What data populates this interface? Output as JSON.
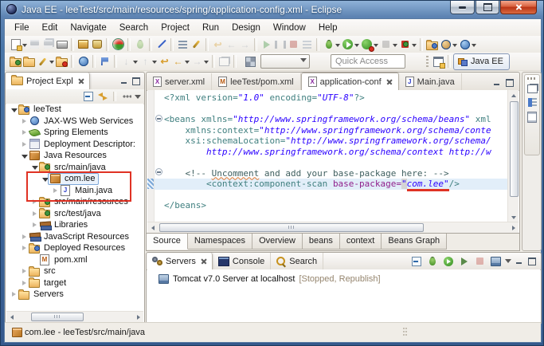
{
  "window": {
    "title": "Java EE - leeTest/src/main/resources/spring/application-config.xml - Eclipse"
  },
  "menu_bar": {
    "items": [
      "File",
      "Edit",
      "Navigate",
      "Search",
      "Project",
      "Run",
      "Design",
      "Window",
      "Help"
    ]
  },
  "toolbar": {
    "quick_access": {
      "placeholder": "Quick Access"
    },
    "perspective": {
      "label": "Java EE"
    },
    "row1_icon_names": [
      "new-wizard-icon",
      "save-icon",
      "save-all-icon",
      "print-icon",
      "export-jar-icon",
      "javadoc-icon",
      "maven-update-icon",
      "skip-breakpoints-icon",
      "mark-occurrences-icon",
      "pin-editor-icon",
      "resume-icon",
      "suspend-icon",
      "terminate-icon",
      "debug-icon",
      "run-icon",
      "coverage-icon",
      "stop-icon",
      "relaunch-icon",
      "new-server-icon",
      "web-browser-icon"
    ],
    "row2_icon_names": [
      "import-icon",
      "export-icon",
      "highlighter-icon",
      "synchronize-icon",
      "web-globe-icon",
      "validate-icon",
      "next-annotation-icon",
      "previous-annotation-icon",
      "last-edit-location-icon",
      "back-icon",
      "forward-icon",
      "grid-view-icon",
      "open-perspective-icon"
    ]
  },
  "file_icons": {
    "xml": "X",
    "maven": "M",
    "java": "J"
  },
  "project_explorer": {
    "title": "Project Expl",
    "tree": [
      {
        "label": "leeTest",
        "depth": 0,
        "state": "expanded",
        "icon": "project"
      },
      {
        "label": "JAX-WS Web Services",
        "depth": 1,
        "state": "collapsed",
        "icon": "webservices"
      },
      {
        "label": "Spring Elements",
        "depth": 1,
        "state": "collapsed",
        "icon": "spring-leaf"
      },
      {
        "label": "Deployment Descriptor:",
        "depth": 1,
        "state": "collapsed",
        "icon": "descriptor"
      },
      {
        "label": "Java Resources",
        "depth": 1,
        "state": "expanded",
        "icon": "java-resources"
      },
      {
        "label": "src/main/java",
        "depth": 2,
        "state": "expanded",
        "icon": "source-folder"
      },
      {
        "label": "com.lee",
        "depth": 3,
        "state": "expanded",
        "icon": "package",
        "selected": true,
        "annotated": true
      },
      {
        "label": "Main.java",
        "depth": 4,
        "state": "collapsed",
        "icon": "java-file",
        "annotated": true
      },
      {
        "label": "src/main/resources",
        "depth": 2,
        "state": "collapsed",
        "icon": "source-folder"
      },
      {
        "label": "src/test/java",
        "depth": 2,
        "state": "collapsed",
        "icon": "source-folder"
      },
      {
        "label": "Libraries",
        "depth": 2,
        "state": "collapsed",
        "icon": "libraries"
      },
      {
        "label": "JavaScript Resources",
        "depth": 1,
        "state": "collapsed",
        "icon": "libraries"
      },
      {
        "label": "Deployed Resources",
        "depth": 1,
        "state": "collapsed",
        "icon": "deployed-folder"
      },
      {
        "label": "pom.xml",
        "depth": 1,
        "state": "leaf",
        "icon": "maven-file"
      },
      {
        "label": "src",
        "depth": 1,
        "state": "collapsed",
        "icon": "folder"
      },
      {
        "label": "target",
        "depth": 1,
        "state": "collapsed",
        "icon": "folder"
      },
      {
        "label": "Servers",
        "depth": 0,
        "state": "collapsed",
        "icon": "folder"
      }
    ]
  },
  "editor": {
    "tabs": [
      {
        "label": "server.xml",
        "icon": "xml",
        "active": false
      },
      {
        "label": "leeTest/pom.xml",
        "icon": "maven",
        "active": false
      },
      {
        "label": "application-conf",
        "icon": "xml",
        "active": true
      },
      {
        "label": "Main.java",
        "icon": "java",
        "active": false
      }
    ],
    "page_tabs": [
      {
        "label": "Source",
        "active": true
      },
      {
        "label": "Namespaces",
        "active": false
      },
      {
        "label": "Overview",
        "active": false
      },
      {
        "label": "beans",
        "active": false
      },
      {
        "label": "context",
        "active": false
      },
      {
        "label": "Beans Graph",
        "active": false
      }
    ],
    "code": [
      {
        "s": [
          {
            "t": "<?xml ",
            "k": "tag"
          },
          {
            "t": "version=",
            "k": "attr"
          },
          {
            "t": "\"1.0\"",
            "k": "val"
          },
          {
            "t": " ",
            "k": "txt"
          },
          {
            "t": "encoding=",
            "k": "attr"
          },
          {
            "t": "\"UTF-8\"",
            "k": "val"
          },
          {
            "t": "?>",
            "k": "tag"
          }
        ]
      },
      {
        "s": []
      },
      {
        "s": [
          {
            "t": "<beans ",
            "k": "tag"
          },
          {
            "t": "xmlns=",
            "k": "attr"
          },
          {
            "t": "\"http://www.springframework.org/schema/beans\"",
            "k": "val"
          },
          {
            "t": " ",
            "k": "txt"
          },
          {
            "t": "xml",
            "k": "attr"
          }
        ]
      },
      {
        "s": [
          {
            "t": "    ",
            "k": "txt"
          },
          {
            "t": "xmlns:context=",
            "k": "attr"
          },
          {
            "t": "\"http://www.springframework.org/schema/conte",
            "k": "val"
          }
        ]
      },
      {
        "s": [
          {
            "t": "    ",
            "k": "txt"
          },
          {
            "t": "xsi:schemaLocation=",
            "k": "attr"
          },
          {
            "t": "\"http://www.springframework.org/schema/",
            "k": "val"
          }
        ]
      },
      {
        "s": [
          {
            "t": "        ",
            "k": "txt"
          },
          {
            "t": "http://www.springframework.org/schema/context http://w",
            "k": "val"
          }
        ]
      },
      {
        "s": []
      },
      {
        "s": [
          {
            "t": "    ",
            "k": "txt"
          },
          {
            "t": "<!-- ",
            "k": "com"
          },
          {
            "t": "Uncomment",
            "k": "comsp"
          },
          {
            "t": " and add your base-package here: -->",
            "k": "com"
          }
        ]
      },
      {
        "s": [
          {
            "t": "        ",
            "k": "txt"
          },
          {
            "t": "<context:component-scan ",
            "k": "tag"
          },
          {
            "t": "base-package=",
            "k": "attrp"
          },
          {
            "t": "\"",
            "k": "valq"
          },
          {
            "t": "com.lee\"",
            "k": "valr"
          },
          {
            "t": "/>",
            "k": "tag"
          }
        ]
      },
      {
        "s": []
      },
      {
        "s": [
          {
            "t": "</beans>",
            "k": "tag"
          }
        ]
      }
    ]
  },
  "servers_view": {
    "tabs": [
      {
        "label": "Servers",
        "active": true,
        "icon": "servers"
      },
      {
        "label": "Console",
        "active": false,
        "icon": "console"
      },
      {
        "label": "Search",
        "active": false,
        "icon": "search"
      }
    ],
    "server_entry": {
      "name": "Tomcat v7.0 Server at localhost",
      "status": "[Stopped, Republish]"
    }
  },
  "status_bar": {
    "text": "com.lee - leeTest/src/main/java"
  },
  "colors": {
    "tag": "#3F7F7F",
    "attribute": "#3F7F7F",
    "attribute_purple": "#90208C",
    "value": "#2A00FF",
    "comment": "#3F5F5F",
    "annotation_red": "#E03224",
    "line_highlight": "#E2EEF9",
    "title_bar_blue": "#4A76A8",
    "status_muted": "#95856E"
  }
}
